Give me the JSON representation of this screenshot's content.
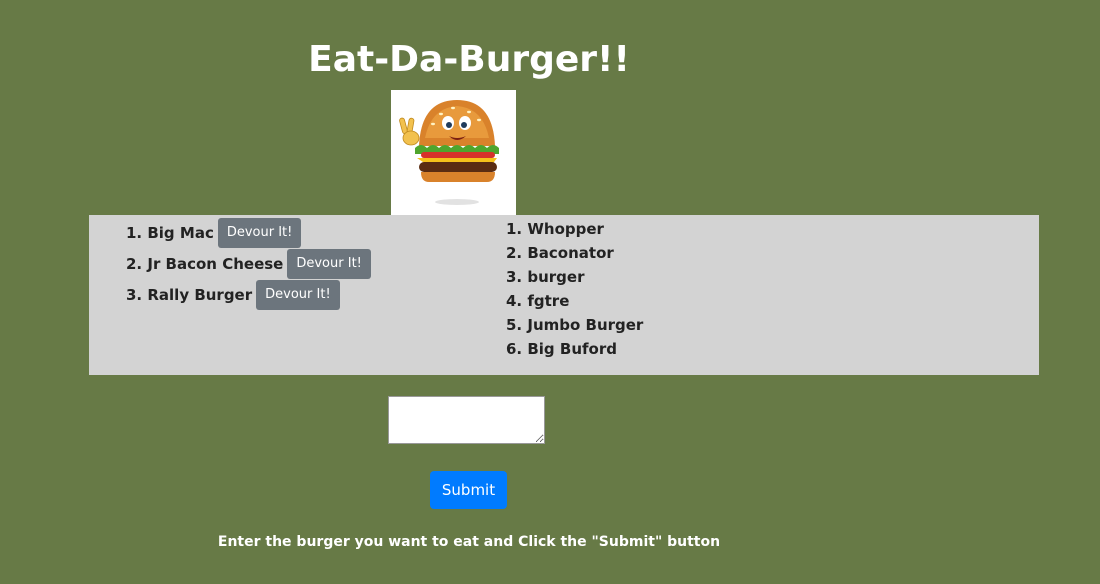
{
  "header": {
    "title": "Eat-Da-Burger!!"
  },
  "logo": {
    "icon": "cartoon-burger-icon"
  },
  "uneaten_burgers": [
    {
      "label": "1. Big Mac",
      "button_label": "Devour It!"
    },
    {
      "label": "2. Jr Bacon Cheese",
      "button_label": "Devour It!"
    },
    {
      "label": "3. Rally Burger",
      "button_label": "Devour It!"
    }
  ],
  "devoured_burgers": [
    {
      "label": "1. Whopper"
    },
    {
      "label": "2. Baconator"
    },
    {
      "label": "3. burger"
    },
    {
      "label": "4. fgtre"
    },
    {
      "label": "5. Jumbo Burger"
    },
    {
      "label": "6. Big Buford"
    }
  ],
  "form": {
    "input_value": "",
    "submit_label": "Submit",
    "instructions": "Enter the burger you want to eat and Click the \"Submit\" button"
  },
  "colors": {
    "background": "#677a46",
    "panel": "#d3d3d3",
    "devour_button": "#6c757d",
    "submit_button": "#007bff"
  }
}
